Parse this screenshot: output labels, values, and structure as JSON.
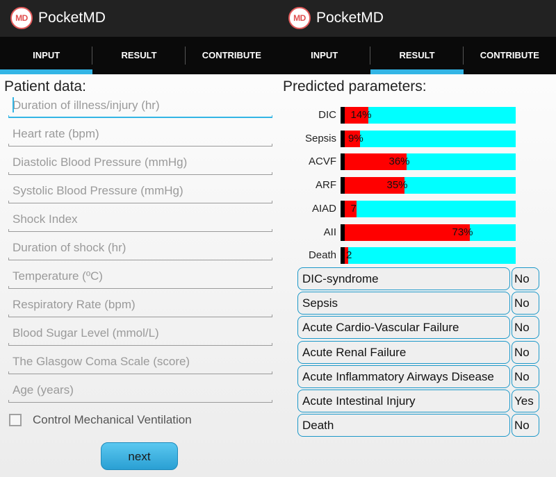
{
  "app": {
    "logo_text": "MD",
    "title": "PocketMD"
  },
  "tabs": [
    "INPUT",
    "RESULT",
    "CONTRIBUTE"
  ],
  "input_screen": {
    "active_tab": 0,
    "section_title": "Patient data:",
    "fields": [
      {
        "placeholder": "Duration of illness/injury (hr)",
        "value": "",
        "focused": true
      },
      {
        "placeholder": "Heart rate (bpm)",
        "value": ""
      },
      {
        "placeholder": "Diastolic Blood Pressure (mmHg)",
        "value": ""
      },
      {
        "placeholder": "Systolic Blood Pressure (mmHg)",
        "value": ""
      },
      {
        "placeholder": "Shock Index",
        "value": ""
      },
      {
        "placeholder": "Duration of shock (hr)",
        "value": ""
      },
      {
        "placeholder": "Temperature (ºC)",
        "value": ""
      },
      {
        "placeholder": "Respiratory Rate (bpm)",
        "value": ""
      },
      {
        "placeholder": "Blood Sugar Level (mmol/L)",
        "value": ""
      },
      {
        "placeholder": "The Glasgow Coma Scale (score)",
        "value": ""
      },
      {
        "placeholder": "Age (years)",
        "value": ""
      }
    ],
    "checkbox": {
      "label": "Control Mechanical Ventilation",
      "checked": false
    },
    "next_label": "next"
  },
  "result_screen": {
    "active_tab": 1,
    "section_title": "Predicted parameters:",
    "bars": [
      {
        "label": "DIC",
        "fraction": 0.14,
        "text": "14%"
      },
      {
        "label": "Sepsis",
        "fraction": 0.09,
        "text": "9%"
      },
      {
        "label": "ACVF",
        "fraction": 0.36,
        "text": "36%"
      },
      {
        "label": "ARF",
        "fraction": 0.35,
        "text": "35%"
      },
      {
        "label": "AIAD",
        "fraction": 0.07,
        "text": "7"
      },
      {
        "label": "AII",
        "fraction": 0.73,
        "text": "73%"
      },
      {
        "label": "Death",
        "fraction": 0.02,
        "text": "2"
      }
    ],
    "outcomes": [
      {
        "name": "DIC-syndrome",
        "value": "No"
      },
      {
        "name": "Sepsis",
        "value": "No"
      },
      {
        "name": "Acute Cardio-Vascular Failure",
        "value": "No"
      },
      {
        "name": "Acute Renal Failure",
        "value": "No"
      },
      {
        "name": "Acute Inflammatory Airways Disease",
        "value": "No"
      },
      {
        "name": "Acute Intestinal Injury",
        "value": "Yes"
      },
      {
        "name": "Death",
        "value": "No"
      }
    ]
  },
  "colors": {
    "accent": "#33b5e5",
    "bar_fill": "#ff0000",
    "bar_track": "#00ffff",
    "outcome_border": "#1c98c9"
  }
}
